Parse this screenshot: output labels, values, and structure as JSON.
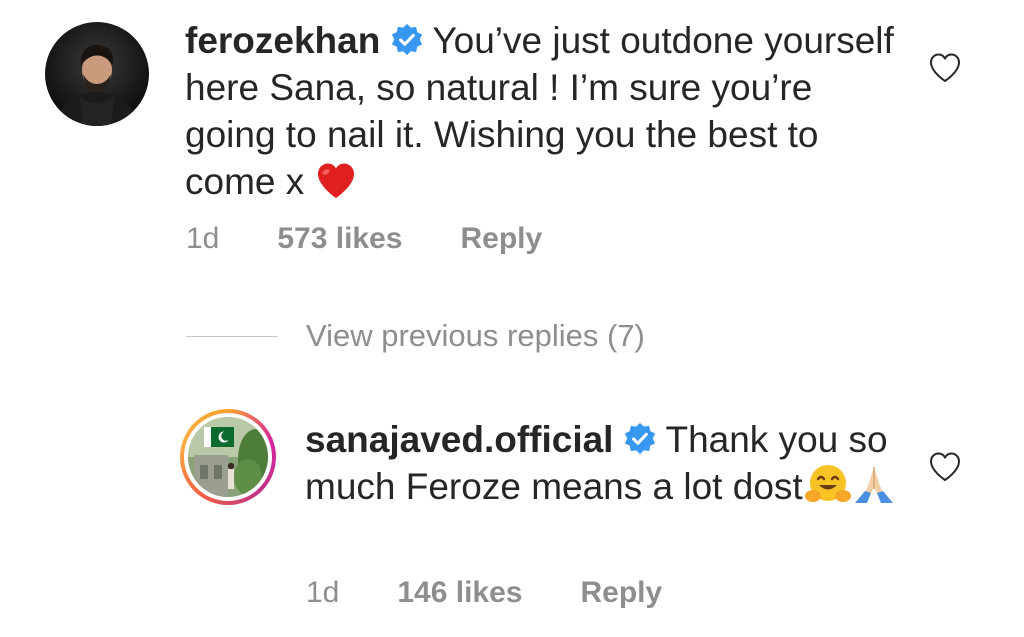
{
  "comments": [
    {
      "username": "ferozekhan",
      "verified": true,
      "text": "You’ve just outdone yourself here Sana, so natural ! I’m sure you’re going to nail it. Wishing you the best to come x",
      "emoji_icon": "red-heart",
      "time": "1d",
      "likes": "573 likes",
      "reply_label": "Reply"
    },
    {
      "username": "sanajaved.official",
      "verified": true,
      "text": "Thank you so much Feroze means a lot dost",
      "emoji_icons": [
        "hugging-face",
        "folded-hands"
      ],
      "time": "1d",
      "likes": "146 likes",
      "reply_label": "Reply"
    }
  ],
  "view_previous_replies": "View previous replies (7)",
  "colors": {
    "text": "#262626",
    "meta": "#8e8e8e",
    "verified_blue": "#3897f0",
    "heart_red": "#e0201f"
  }
}
